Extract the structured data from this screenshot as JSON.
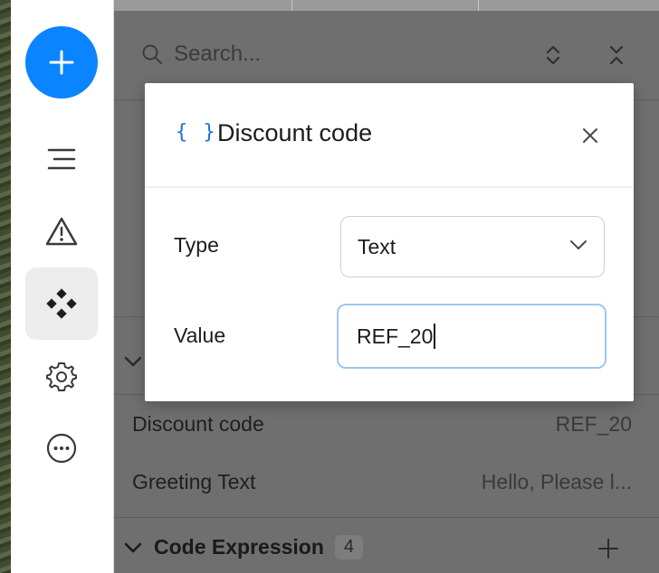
{
  "sidebar": {
    "fab_icon": "plus-icon",
    "items": [
      {
        "icon": "list-lines-icon"
      },
      {
        "icon": "warning-icon"
      },
      {
        "icon": "components-icon",
        "active": true
      },
      {
        "icon": "gear-icon"
      },
      {
        "icon": "more-options-icon"
      }
    ]
  },
  "search": {
    "placeholder": "Search..."
  },
  "list": {
    "rows": [
      {
        "label": "Discount code",
        "value": "REF_20"
      },
      {
        "label": "Greeting Text",
        "value": "Hello, Please l..."
      }
    ],
    "section": {
      "title": "Code Expression",
      "count": "4"
    }
  },
  "dialog": {
    "title": "Discount code",
    "title_icon": "{ }",
    "type_label": "Type",
    "type_value": "Text",
    "value_label": "Value",
    "value_text": "REF_20"
  },
  "colors": {
    "accent": "#0a84ff",
    "brace_blue": "#1e6fd9",
    "focus_border": "#9cc6f5"
  }
}
